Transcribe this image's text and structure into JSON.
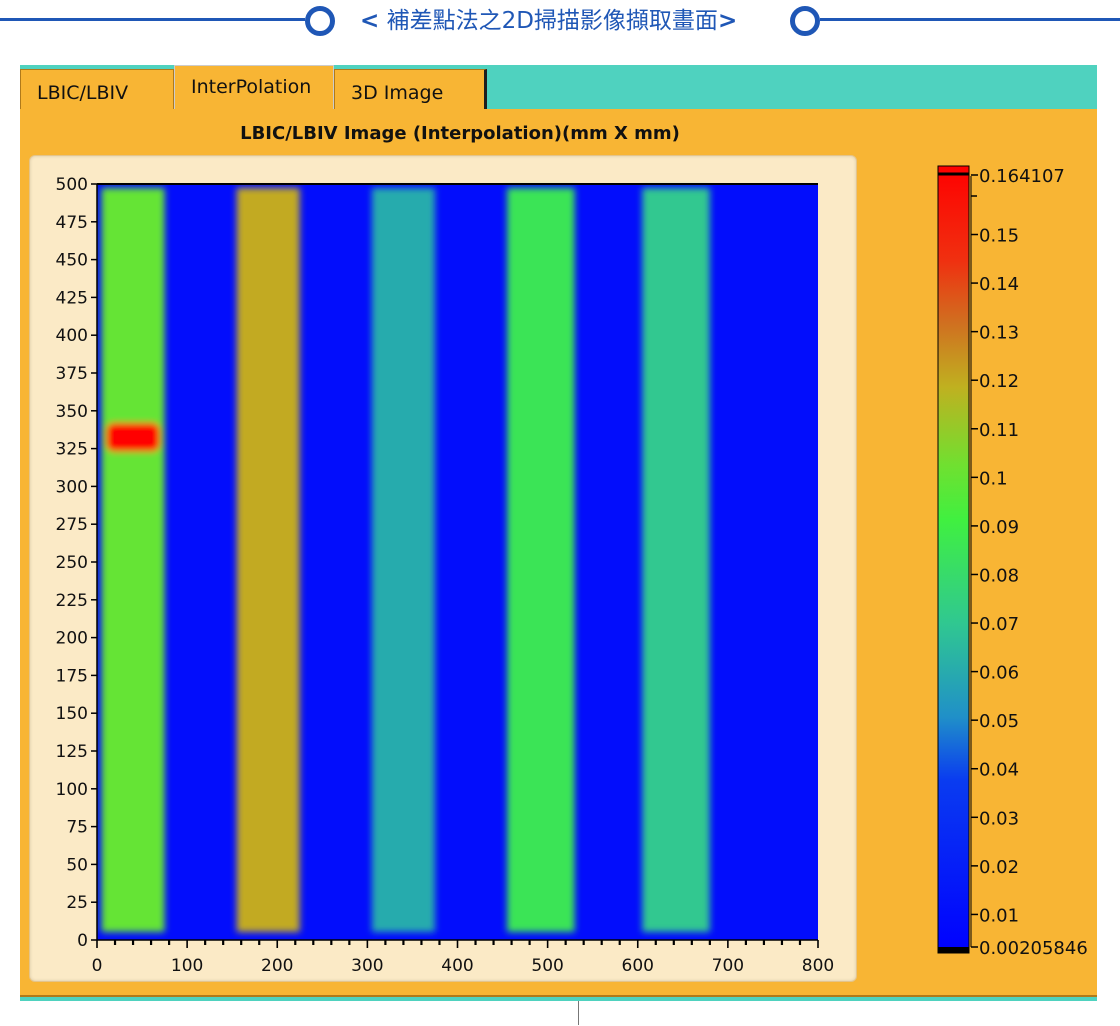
{
  "banner": {
    "left_bracket": "<",
    "title": " 補差點法之2D掃描影像擷取畫面",
    "right_bracket": ">"
  },
  "tabs": [
    {
      "label": "LBIC/LBIV",
      "active": false
    },
    {
      "label": "InterPolation",
      "active": true
    },
    {
      "label": "3D Image",
      "active": false
    }
  ],
  "colors": {
    "banner_blue": "#1f57b6",
    "panel_orange": "#f8b534",
    "tab_teal": "#4fd2bf"
  },
  "chart_data": {
    "type": "heatmap",
    "title": "LBIC/LBIV Image (Interpolation)(mm X mm)",
    "xlim": [
      0,
      800
    ],
    "ylim": [
      0,
      500
    ],
    "x_ticks": [
      0,
      100,
      200,
      300,
      400,
      500,
      600,
      700,
      800
    ],
    "y_ticks": [
      0,
      25,
      50,
      75,
      100,
      125,
      150,
      175,
      200,
      225,
      250,
      275,
      300,
      325,
      350,
      375,
      400,
      425,
      450,
      475,
      500
    ],
    "background_value": 0.01,
    "bands": [
      {
        "x_start": 5,
        "x_end": 75,
        "value": 0.1
      },
      {
        "x_start": 155,
        "x_end": 225,
        "value": 0.12
      },
      {
        "x_start": 305,
        "x_end": 375,
        "value": 0.06
      },
      {
        "x_start": 455,
        "x_end": 530,
        "value": 0.085
      },
      {
        "x_start": 605,
        "x_end": 680,
        "value": 0.07
      }
    ],
    "hotspot": {
      "x_start": 10,
      "x_end": 70,
      "y_start": 323,
      "y_end": 342,
      "value": 0.164
    },
    "colorbar": {
      "min": 0.00205846,
      "max": 0.164107,
      "labels": [
        "0.164107",
        "0.15",
        "0.14",
        "0.13",
        "0.12",
        "0.11",
        "0.1",
        "0.09",
        "0.08",
        "0.07",
        "0.06",
        "0.05",
        "0.04",
        "0.03",
        "0.02",
        "0.01",
        "0.00205846"
      ],
      "values": [
        0.164107,
        0.15,
        0.14,
        0.13,
        0.12,
        0.11,
        0.1,
        0.09,
        0.08,
        0.07,
        0.06,
        0.05,
        0.04,
        0.03,
        0.02,
        0.01,
        0.00205846
      ]
    }
  }
}
